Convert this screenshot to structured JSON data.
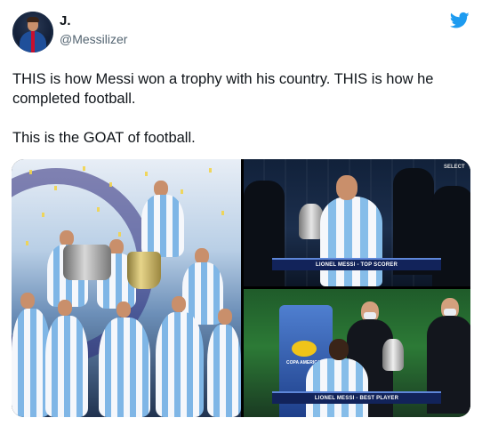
{
  "tweet": {
    "display_name": "J.",
    "handle": "@Messilizer",
    "text_paragraphs": [
      "THIS is how Messi won a trophy with his country. THIS is how he completed football.",
      "This is the GOAT of football."
    ],
    "logo_icon": "twitter-bird-icon"
  },
  "media": {
    "top_right": {
      "badge": "SELECT",
      "caption": "LIONEL MESSI - TOP SCORER"
    },
    "bottom_right": {
      "caption": "LIONEL MESSI - BEST PLAYER",
      "logo_text": "COPA AMERICA"
    }
  },
  "colors": {
    "twitter_blue": "#1d9bf0",
    "text_primary": "#0f1419",
    "text_secondary": "#536471"
  }
}
